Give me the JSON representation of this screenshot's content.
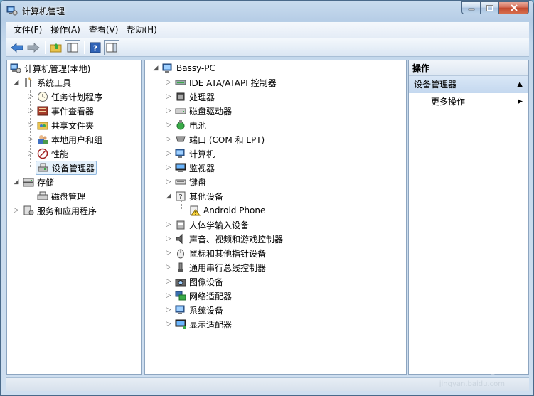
{
  "window": {
    "title": "计算机管理"
  },
  "menu": [
    "文件(F)",
    "操作(A)",
    "查看(V)",
    "帮助(H)"
  ],
  "left_tree": {
    "root": "计算机管理(本地)",
    "system_tools": "系统工具",
    "system_children": [
      "任务计划程序",
      "事件查看器",
      "共享文件夹",
      "本地用户和组",
      "性能",
      "设备管理器"
    ],
    "storage": "存储",
    "storage_children": [
      "磁盘管理"
    ],
    "services": "服务和应用程序"
  },
  "device_tree": {
    "root": "Bassy-PC",
    "categories": [
      "IDE ATA/ATAPI 控制器",
      "处理器",
      "磁盘驱动器",
      "电池",
      "端口 (COM 和 LPT)",
      "计算机",
      "监视器",
      "键盘",
      "其他设备",
      "人体学输入设备",
      "声音、视频和游戏控制器",
      "鼠标和其他指针设备",
      "通用串行总线控制器",
      "图像设备",
      "网络适配器",
      "系统设备",
      "显示适配器"
    ],
    "other_device_child": "Android Phone"
  },
  "actions": {
    "header": "操作",
    "section": "设备管理器",
    "more": "更多操作"
  },
  "watermark": {
    "brand": "Bai 经验",
    "url": "jingyan.baidu.com"
  }
}
